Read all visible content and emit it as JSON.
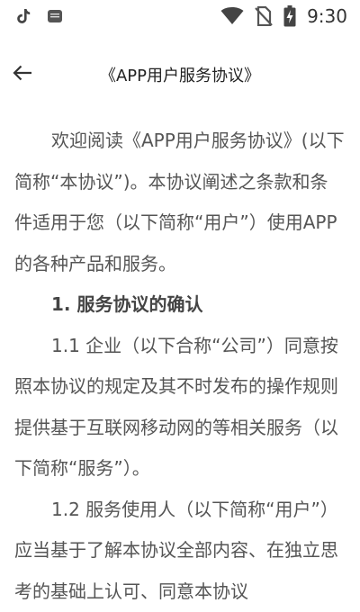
{
  "status_bar": {
    "time": "9:30",
    "icons": [
      "tiktok-icon",
      "notification-app-icon",
      "wifi-icon",
      "no-sim-icon",
      "battery-charging-icon"
    ]
  },
  "app_bar": {
    "back_icon": "arrow-left-icon",
    "title": "《APP用户服务协议》"
  },
  "content": {
    "intro": "欢迎阅读《APP用户服务协议》(以下简称“本协议”)。本协议阐述之条款和条件适用于您（以下简称“用户”）使用APP的各种产品和服务。",
    "section1_heading": "1. 服务协议的确认",
    "clause_1_1": "1.1 企业（以下合称“公司”）同意按照本协议的规定及其不时发布的操作规则提供基于互联网移动网的等相关服务（以下简称“服务”）。",
    "clause_1_2": "1.2 服务使用人（以下简称“用户”）应当基于了解本协议全部内容、在独立思考的基础上认可、同意本协议"
  }
}
